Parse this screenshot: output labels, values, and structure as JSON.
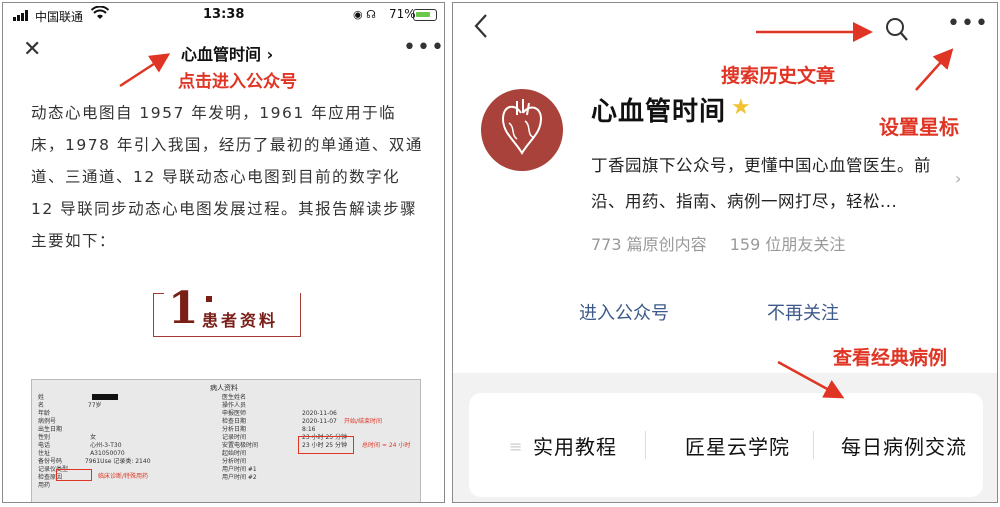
{
  "left_phone": {
    "status": {
      "carrier": "中国联通",
      "time": "13:38",
      "battery": "71%"
    },
    "nav": {
      "title": "心血管时间 ›"
    },
    "annotation": "点击进入公众号",
    "article_text": "动态心电图自 1957 年发明，1961 年应用于临床，1978 年引入我国，经历了最初的单通道、双通道、三通道、12 导联动态心电图到目前的数字化 12 导联同步动态心电图发展过程。其报告解读步骤主要如下：",
    "section": {
      "number": "1",
      "label": "患者资料"
    },
    "doc_image": {
      "title": "病人资料",
      "col1": [
        "姓",
        "名",
        "年龄",
        "病例号",
        "出生日期",
        "性别",
        "电话",
        "住址",
        "备份号码",
        "记录仪类型",
        "检查原因",
        "用药"
      ],
      "age": "77岁",
      "col2": [
        "医生姓名",
        "操作人员",
        "申报医师",
        "检查日期",
        "分析日期",
        "记录时间",
        "安置电极时间",
        "起始时间",
        "分析时间",
        "用户时间 #1",
        "用户时间 #2"
      ],
      "col3": [
        "2020-11-06",
        "2020-11-07",
        "8:16",
        "23 小时 25 分钟",
        "23 小时 25 分钟"
      ],
      "device": [
        "女",
        "心州-3-T30",
        "A31050070",
        "7961Use",
        "记录类: 2140"
      ],
      "red_note1": "开始/结束时间",
      "red_note2": "总时间 ≈ 24 小时",
      "red_note3": "临床诊断/特殊用药"
    }
  },
  "right_phone": {
    "annotations": {
      "search": "搜索历史文章",
      "star": "设置星标",
      "cases": "查看经典病例"
    },
    "account": {
      "name": "心血管时间",
      "description": "丁香园旗下公众号，更懂中国心血管医生。前沿、用药、指南、病例一网打尽，轻松...",
      "original_count": "773 篇原创内容",
      "followers": "159 位朋友关注"
    },
    "buttons": {
      "enter": "进入公众号",
      "unfollow": "不再关注"
    },
    "menu": [
      "实用教程",
      "匠星云学院",
      "每日病例交流"
    ]
  },
  "colors": {
    "annotation_red": "#e03524",
    "link_blue": "#3c5a8b",
    "avatar_red": "#a8423a",
    "star_yellow": "#f1c232"
  }
}
